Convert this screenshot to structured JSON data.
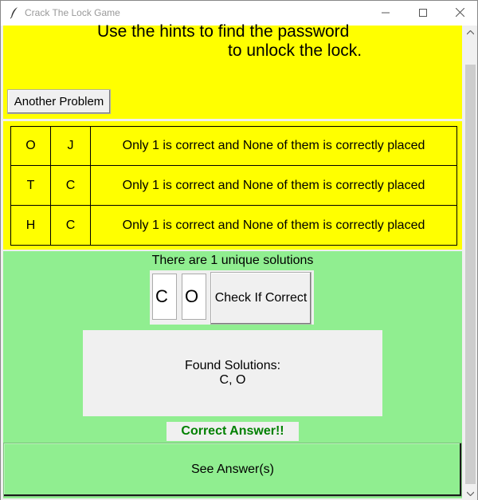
{
  "window": {
    "title": "Crack The Lock Game",
    "title_icon": "feather-icon",
    "minimize_icon": "minimize-icon",
    "maximize_icon": "maximize-icon",
    "close_icon": "close-icon"
  },
  "header": {
    "line1": "Use the hints to find the password",
    "line2": "to unlock the lock.",
    "another_problem_label": "Another Problem"
  },
  "hints": [
    {
      "letter1": "O",
      "letter2": "J",
      "text": "Only 1 is correct and None of them is correctly placed"
    },
    {
      "letter1": "T",
      "letter2": "C",
      "text": "Only 1 is correct and None of them is correctly placed"
    },
    {
      "letter1": "H",
      "letter2": "C",
      "text": "Only 1 is correct and None of them is correctly placed"
    }
  ],
  "solver": {
    "unique_text": "There are 1 unique solutions",
    "input1": "C",
    "input2": "O",
    "check_label": "Check If Correct",
    "found_title": "Found Solutions:",
    "found_value": "C, O",
    "result_text": "Correct Answer!!",
    "see_answer_label": "See Answer(s)"
  },
  "colors": {
    "panel_yellow": "#ffff00",
    "panel_green": "#90ee90",
    "correct_text": "#008000"
  }
}
